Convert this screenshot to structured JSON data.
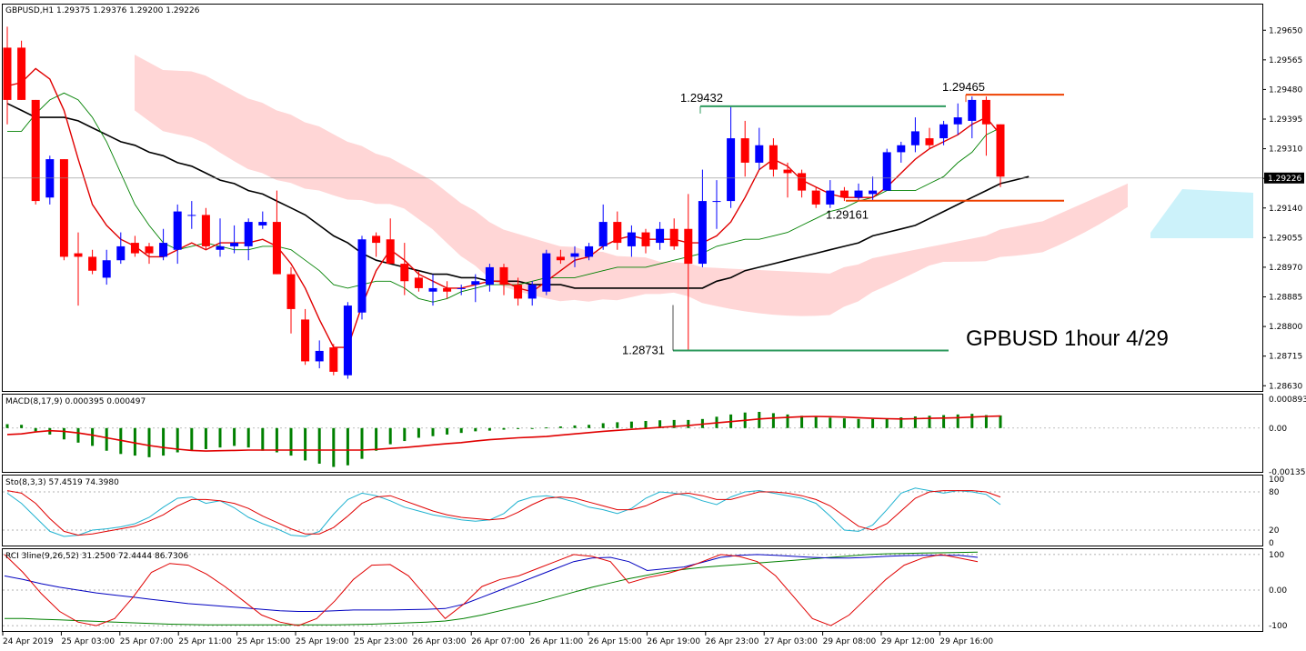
{
  "chart_data": {
    "type": "candlestick",
    "symbol_header": "GBPUSD,H1  1.29375 1.29376 1.29200 1.29226",
    "watermark": "GPBUSD 1hour 4/29",
    "price_axis": {
      "ylim": [
        1.28615,
        1.29695
      ],
      "ticks": [
        "1.29650",
        "1.29565",
        "1.29480",
        "1.29395",
        "1.29310",
        "1.29225",
        "1.29140",
        "1.29055",
        "1.28970",
        "1.28885",
        "1.28800",
        "1.28715",
        "1.28630"
      ],
      "current_price": "1.29226"
    },
    "time_labels": [
      "24 Apr 2019",
      "25 Apr 03:00",
      "25 Apr 07:00",
      "25 Apr 11:00",
      "25 Apr 15:00",
      "25 Apr 19:00",
      "25 Apr 23:00",
      "26 Apr 03:00",
      "26 Apr 07:00",
      "26 Apr 11:00",
      "26 Apr 15:00",
      "26 Apr 19:00",
      "26 Apr 23:00",
      "27 Apr 03:00",
      "29 Apr 08:00",
      "29 Apr 12:00",
      "29 Apr 16:00"
    ],
    "candles": [
      {
        "o": 1.296,
        "h": 1.2966,
        "l": 1.2938,
        "c": 1.2945
      },
      {
        "o": 1.296,
        "h": 1.2962,
        "l": 1.2945,
        "c": 1.2945
      },
      {
        "o": 1.2945,
        "h": 1.2945,
        "l": 1.2915,
        "c": 1.2916
      },
      {
        "o": 1.2917,
        "h": 1.2929,
        "l": 1.2915,
        "c": 1.2928
      },
      {
        "o": 1.2928,
        "h": 1.2928,
        "l": 1.2899,
        "c": 1.29
      },
      {
        "o": 1.2901,
        "h": 1.2907,
        "l": 1.2886,
        "c": 1.29
      },
      {
        "o": 1.29,
        "h": 1.2902,
        "l": 1.2895,
        "c": 1.2896
      },
      {
        "o": 1.2894,
        "h": 1.2902,
        "l": 1.2892,
        "c": 1.2899
      },
      {
        "o": 1.2899,
        "h": 1.2907,
        "l": 1.2898,
        "c": 1.2903
      },
      {
        "o": 1.2904,
        "h": 1.2906,
        "l": 1.29,
        "c": 1.2901
      },
      {
        "o": 1.2903,
        "h": 1.2904,
        "l": 1.2898,
        "c": 1.2901
      },
      {
        "o": 1.29,
        "h": 1.2908,
        "l": 1.2899,
        "c": 1.2904
      },
      {
        "o": 1.2902,
        "h": 1.2915,
        "l": 1.2898,
        "c": 1.2913
      },
      {
        "o": 1.2912,
        "h": 1.2916,
        "l": 1.2908,
        "c": 1.2912
      },
      {
        "o": 1.2912,
        "h": 1.2914,
        "l": 1.2902,
        "c": 1.2903
      },
      {
        "o": 1.2902,
        "h": 1.2911,
        "l": 1.29,
        "c": 1.2903
      },
      {
        "o": 1.2903,
        "h": 1.2909,
        "l": 1.2901,
        "c": 1.2904
      },
      {
        "o": 1.2903,
        "h": 1.2911,
        "l": 1.2899,
        "c": 1.291
      },
      {
        "o": 1.2909,
        "h": 1.2913,
        "l": 1.2908,
        "c": 1.291
      },
      {
        "o": 1.291,
        "h": 1.2919,
        "l": 1.2895,
        "c": 1.2895
      },
      {
        "o": 1.2895,
        "h": 1.2897,
        "l": 1.2878,
        "c": 1.2885
      },
      {
        "o": 1.2882,
        "h": 1.2885,
        "l": 1.2869,
        "c": 1.287
      },
      {
        "o": 1.287,
        "h": 1.2876,
        "l": 1.2868,
        "c": 1.2873
      },
      {
        "o": 1.2874,
        "h": 1.2875,
        "l": 1.2866,
        "c": 1.2867
      },
      {
        "o": 1.2866,
        "h": 1.2887,
        "l": 1.2865,
        "c": 1.2886
      },
      {
        "o": 1.2884,
        "h": 1.2906,
        "l": 1.2882,
        "c": 1.2905
      },
      {
        "o": 1.2906,
        "h": 1.2907,
        "l": 1.29,
        "c": 1.2904
      },
      {
        "o": 1.2905,
        "h": 1.2911,
        "l": 1.2898,
        "c": 1.2898
      },
      {
        "o": 1.2898,
        "h": 1.2904,
        "l": 1.2889,
        "c": 1.2893
      },
      {
        "o": 1.2894,
        "h": 1.2896,
        "l": 1.289,
        "c": 1.2891
      },
      {
        "o": 1.289,
        "h": 1.2895,
        "l": 1.2886,
        "c": 1.2891
      },
      {
        "o": 1.2891,
        "h": 1.2893,
        "l": 1.2888,
        "c": 1.289
      },
      {
        "o": 1.2891,
        "h": 1.2892,
        "l": 1.2889,
        "c": 1.2891
      },
      {
        "o": 1.2892,
        "h": 1.2895,
        "l": 1.2887,
        "c": 1.2893
      },
      {
        "o": 1.2892,
        "h": 1.2898,
        "l": 1.289,
        "c": 1.2897
      },
      {
        "o": 1.2897,
        "h": 1.2898,
        "l": 1.2889,
        "c": 1.2892
      },
      {
        "o": 1.2892,
        "h": 1.2894,
        "l": 1.2886,
        "c": 1.2888
      },
      {
        "o": 1.2888,
        "h": 1.2893,
        "l": 1.2886,
        "c": 1.2892
      },
      {
        "o": 1.289,
        "h": 1.2902,
        "l": 1.2889,
        "c": 1.2901
      },
      {
        "o": 1.29,
        "h": 1.2902,
        "l": 1.2898,
        "c": 1.2899
      },
      {
        "o": 1.29,
        "h": 1.2903,
        "l": 1.2897,
        "c": 1.2901
      },
      {
        "o": 1.29,
        "h": 1.2904,
        "l": 1.2899,
        "c": 1.2903
      },
      {
        "o": 1.2903,
        "h": 1.2915,
        "l": 1.2902,
        "c": 1.291
      },
      {
        "o": 1.291,
        "h": 1.2913,
        "l": 1.2902,
        "c": 1.2904
      },
      {
        "o": 1.2903,
        "h": 1.2909,
        "l": 1.29,
        "c": 1.2907
      },
      {
        "o": 1.2907,
        "h": 1.2908,
        "l": 1.2901,
        "c": 1.2903
      },
      {
        "o": 1.2904,
        "h": 1.291,
        "l": 1.2902,
        "c": 1.2908
      },
      {
        "o": 1.2908,
        "h": 1.2911,
        "l": 1.2902,
        "c": 1.2903
      },
      {
        "o": 1.2908,
        "h": 1.2918,
        "l": 1.2873,
        "c": 1.2898
      },
      {
        "o": 1.2898,
        "h": 1.2925,
        "l": 1.2897,
        "c": 1.2916
      },
      {
        "o": 1.2916,
        "h": 1.2922,
        "l": 1.2908,
        "c": 1.2916
      },
      {
        "o": 1.2916,
        "h": 1.2943,
        "l": 1.2914,
        "c": 1.2934
      },
      {
        "o": 1.2934,
        "h": 1.2939,
        "l": 1.2923,
        "c": 1.2927
      },
      {
        "o": 1.2927,
        "h": 1.2937,
        "l": 1.2925,
        "c": 1.2932
      },
      {
        "o": 1.2932,
        "h": 1.2934,
        "l": 1.2923,
        "c": 1.2925
      },
      {
        "o": 1.2925,
        "h": 1.2927,
        "l": 1.2917,
        "c": 1.2924
      },
      {
        "o": 1.2924,
        "h": 1.2925,
        "l": 1.2917,
        "c": 1.2919
      },
      {
        "o": 1.2919,
        "h": 1.292,
        "l": 1.2914,
        "c": 1.2915
      },
      {
        "o": 1.2915,
        "h": 1.2922,
        "l": 1.2914,
        "c": 1.2919
      },
      {
        "o": 1.2919,
        "h": 1.292,
        "l": 1.2916,
        "c": 1.2917
      },
      {
        "o": 1.2917,
        "h": 1.2921,
        "l": 1.2916,
        "c": 1.2919
      },
      {
        "o": 1.2918,
        "h": 1.2923,
        "l": 1.2916,
        "c": 1.2919
      },
      {
        "o": 1.2919,
        "h": 1.2931,
        "l": 1.2919,
        "c": 1.293
      },
      {
        "o": 1.293,
        "h": 1.2933,
        "l": 1.2927,
        "c": 1.2932
      },
      {
        "o": 1.2932,
        "h": 1.294,
        "l": 1.293,
        "c": 1.2936
      },
      {
        "o": 1.2934,
        "h": 1.2937,
        "l": 1.2931,
        "c": 1.2932
      },
      {
        "o": 1.2934,
        "h": 1.2939,
        "l": 1.2932,
        "c": 1.2938
      },
      {
        "o": 1.2938,
        "h": 1.2944,
        "l": 1.2935,
        "c": 1.294
      },
      {
        "o": 1.2939,
        "h": 1.2946,
        "l": 1.2934,
        "c": 1.2945
      },
      {
        "o": 1.2945,
        "h": 1.2946,
        "l": 1.2929,
        "c": 1.2938
      },
      {
        "o": 1.2938,
        "h": 1.2938,
        "l": 1.292,
        "c": 1.2923
      }
    ],
    "overlays": {
      "fast_ma": {
        "color": "#e00000",
        "values": [
          1.2949,
          1.295,
          1.2954,
          1.2951,
          1.2942,
          1.2928,
          1.2915,
          1.2909,
          1.2905,
          1.2903,
          1.29,
          1.29,
          1.2902,
          1.2904,
          1.2902,
          1.2904,
          1.2904,
          1.2904,
          1.2905,
          1.2903,
          1.2898,
          1.2891,
          1.2882,
          1.2874,
          1.2874,
          1.2886,
          1.2896,
          1.2902,
          1.2899,
          1.2895,
          1.2893,
          1.2891,
          1.2891,
          1.2892,
          1.2893,
          1.2893,
          1.2891,
          1.289,
          1.2893,
          1.2896,
          1.2899,
          1.29,
          1.2903,
          1.2905,
          1.2906,
          1.2905,
          1.2905,
          1.2905,
          1.2904,
          1.2904,
          1.2906,
          1.291,
          1.2917,
          1.2925,
          1.2928,
          1.2926,
          1.2922,
          1.292,
          1.2918,
          1.2917,
          1.2917,
          1.2917,
          1.292,
          1.2924,
          1.2928,
          1.2931,
          1.2933,
          1.2935,
          1.2938,
          1.294,
          1.2935
        ]
      },
      "mid_ma": {
        "color": "#008000",
        "values": [
          1.2936,
          1.2936,
          1.2941,
          1.2945,
          1.2947,
          1.2945,
          1.294,
          1.2933,
          1.2924,
          1.2915,
          1.2909,
          1.2904,
          1.2902,
          1.2903,
          1.2904,
          1.2903,
          1.2902,
          1.2902,
          1.2903,
          1.2903,
          1.2902,
          1.2899,
          1.2896,
          1.2892,
          1.2891,
          1.2892,
          1.2893,
          1.2893,
          1.2891,
          1.2888,
          1.2887,
          1.2888,
          1.289,
          1.2891,
          1.2892,
          1.2892,
          1.2892,
          1.2893,
          1.2894,
          1.2894,
          1.2894,
          1.2895,
          1.2896,
          1.2897,
          1.2897,
          1.2897,
          1.2898,
          1.2899,
          1.29,
          1.2901,
          1.2903,
          1.2904,
          1.2905,
          1.2905,
          1.2906,
          1.2907,
          1.2909,
          1.2911,
          1.2913,
          1.2914,
          1.2916,
          1.2917,
          1.2919,
          1.2919,
          1.2919,
          1.2921,
          1.2923,
          1.2927,
          1.293,
          1.2935,
          1.2937
        ]
      },
      "slow_ma": {
        "color": "#000000",
        "values": [
          1.2944,
          1.2942,
          1.294,
          1.294,
          1.294,
          1.2939,
          1.2937,
          1.2935,
          1.2933,
          1.2932,
          1.293,
          1.2929,
          1.2927,
          1.2926,
          1.2924,
          1.2922,
          1.2921,
          1.2919,
          1.2918,
          1.2916,
          1.2914,
          1.2912,
          1.2909,
          1.2906,
          1.2904,
          1.2901,
          1.2899,
          1.2898,
          1.2897,
          1.2896,
          1.2895,
          1.2895,
          1.2894,
          1.2894,
          1.2893,
          1.2893,
          1.2893,
          1.2892,
          1.2892,
          1.2892,
          1.2891,
          1.2891,
          1.2891,
          1.2891,
          1.2891,
          1.2891,
          1.2891,
          1.2891,
          1.2891,
          1.2891,
          1.2893,
          1.2894,
          1.2896,
          1.2897,
          1.2898,
          1.2899,
          1.29,
          1.2901,
          1.2902,
          1.2903,
          1.2904,
          1.2906,
          1.2907,
          1.2908,
          1.2909,
          1.2911,
          1.2913,
          1.2915,
          1.2917,
          1.2919,
          1.2921,
          1.2922,
          1.2923
        ]
      }
    },
    "cloud": {
      "color": "#ffd6d6",
      "future_color": "#ccf2fa"
    },
    "levels": [
      {
        "label": "1.29432",
        "price": 1.29432,
        "color": "#2e9a5e"
      },
      {
        "label": "1.29465",
        "price": 1.29465,
        "color": "#ee4000"
      },
      {
        "label": "1.29161",
        "price": 1.29161,
        "color": "#ee4000"
      },
      {
        "label": "1.28731",
        "price": 1.28731,
        "color": "#2e9a5e"
      }
    ],
    "macd": {
      "header": "MACD(8,17,9) 0.000395 0.000497",
      "ticks": [
        "0.000893",
        "0.00",
        "-0.001353"
      ],
      "ylim": [
        -0.001353,
        0.000893
      ],
      "hist": [
        0.00012,
        0.0001,
        -0.0001,
        -0.0002,
        -0.00035,
        -0.00045,
        -0.00055,
        -0.0007,
        -0.0008,
        -0.00085,
        -0.0009,
        -0.00085,
        -0.00075,
        -0.0007,
        -0.00065,
        -0.0006,
        -0.00055,
        -0.0006,
        -0.0007,
        -0.00075,
        -0.00085,
        -0.001,
        -0.0011,
        -0.0012,
        -0.00115,
        -0.00095,
        -0.0007,
        -0.0005,
        -0.0004,
        -0.0003,
        -0.00025,
        -0.0002,
        -0.00015,
        -0.0001,
        -8e-05,
        -5e-05,
        -3e-05,
        -2e-05,
        2e-05,
        5e-05,
        8e-05,
        0.0001,
        0.00015,
        0.00018,
        0.0002,
        0.00022,
        0.00024,
        0.00025,
        0.00025,
        0.00028,
        0.00035,
        0.00042,
        0.00048,
        0.0005,
        0.00046,
        0.00042,
        0.00038,
        0.00036,
        0.00032,
        0.0003,
        0.00028,
        0.00028,
        0.0003,
        0.00033,
        0.00036,
        0.00038,
        0.0004,
        0.00042,
        0.00044,
        0.0004,
        0.00039
      ],
      "signal": [
        -0.0002,
        -0.00018,
        -0.00012,
        -8e-05,
        -0.0001,
        -0.00015,
        -0.00022,
        -0.0003,
        -0.00038,
        -0.00046,
        -0.00054,
        -0.0006,
        -0.00065,
        -0.00069,
        -0.00071,
        -0.0007,
        -0.00069,
        -0.00068,
        -0.00068,
        -0.00068,
        -0.00068,
        -0.00068,
        -0.00068,
        -0.00068,
        -0.00068,
        -0.00068,
        -0.00066,
        -0.00063,
        -0.0006,
        -0.00056,
        -0.00052,
        -0.00048,
        -0.00045,
        -0.0004,
        -0.00036,
        -0.00033,
        -0.0003,
        -0.00028,
        -0.00026,
        -0.00022,
        -0.00018,
        -0.00014,
        -0.0001,
        -7e-05,
        -4e-05,
        -1e-05,
        2e-05,
        5e-05,
        8e-05,
        0.00012,
        0.00016,
        0.0002,
        0.00024,
        0.00028,
        0.00031,
        0.00033,
        0.00035,
        0.00036,
        0.00035,
        0.00034,
        0.00032,
        0.0003,
        0.00029,
        0.00028,
        0.00029,
        0.0003,
        0.00031,
        0.00032,
        0.00034,
        0.00036,
        0.00037
      ]
    },
    "stochastic": {
      "header": "Sto(8,3,3) 57.4519 74.3980",
      "ticks": [
        "100",
        "80",
        "20",
        "0"
      ],
      "ylim": [
        0,
        100
      ],
      "k": [
        78,
        62,
        40,
        18,
        10,
        12,
        20,
        22,
        25,
        30,
        40,
        56,
        70,
        72,
        62,
        66,
        55,
        40,
        30,
        22,
        12,
        10,
        18,
        45,
        68,
        78,
        74,
        66,
        56,
        50,
        44,
        40,
        36,
        34,
        36,
        46,
        65,
        72,
        74,
        70,
        64,
        56,
        52,
        46,
        54,
        70,
        80,
        78,
        74,
        66,
        60,
        72,
        80,
        82,
        78,
        74,
        70,
        62,
        42,
        20,
        18,
        28,
        52,
        78,
        86,
        82,
        78,
        82,
        80,
        76,
        60
      ],
      "d": [
        82,
        78,
        62,
        38,
        18,
        12,
        14,
        18,
        22,
        26,
        34,
        44,
        58,
        68,
        68,
        66,
        62,
        54,
        42,
        32,
        22,
        14,
        14,
        24,
        42,
        62,
        72,
        74,
        66,
        58,
        50,
        44,
        40,
        38,
        36,
        38,
        48,
        60,
        70,
        72,
        70,
        64,
        58,
        52,
        52,
        58,
        68,
        76,
        78,
        74,
        68,
        68,
        74,
        80,
        80,
        78,
        74,
        68,
        58,
        42,
        26,
        20,
        30,
        50,
        70,
        80,
        82,
        82,
        82,
        80,
        72
      ]
    },
    "rci": {
      "header": "RCI 3line(9,26,52) 31.2500 72.4444 86.7306",
      "ticks": [
        "100",
        "0.00",
        "-100"
      ],
      "ylim": [
        -110,
        110
      ],
      "short": [
        100,
        50,
        -10,
        -60,
        -90,
        -100,
        -80,
        -20,
        50,
        75,
        70,
        45,
        10,
        -30,
        -70,
        -90,
        -100,
        -80,
        -30,
        30,
        70,
        72,
        40,
        -20,
        -80,
        -40,
        10,
        30,
        40,
        60,
        80,
        100,
        95,
        80,
        20,
        35,
        45,
        60,
        80,
        100,
        95,
        80,
        40,
        -20,
        -80,
        -100,
        -70,
        -20,
        30,
        70,
        90,
        100,
        90,
        80
      ],
      "mid": [
        40,
        30,
        18,
        8,
        0,
        -8,
        -14,
        -20,
        -26,
        -32,
        -38,
        -42,
        -46,
        -50,
        -54,
        -58,
        -60,
        -60,
        -58,
        -56,
        -56,
        -56,
        -55,
        -54,
        -52,
        -40,
        -20,
        0,
        20,
        40,
        60,
        80,
        90,
        92,
        80,
        55,
        60,
        65,
        78,
        92,
        98,
        100,
        98,
        95,
        92,
        90,
        90,
        92,
        95,
        97,
        98,
        98,
        98,
        92
      ],
      "long": [
        -80,
        -80,
        -82,
        -84,
        -86,
        -88,
        -90,
        -92,
        -94,
        -96,
        -97,
        -98,
        -98,
        -98,
        -98,
        -98,
        -98,
        -98,
        -98,
        -97,
        -96,
        -94,
        -92,
        -90,
        -87,
        -80,
        -70,
        -58,
        -46,
        -34,
        -20,
        -6,
        8,
        20,
        32,
        42,
        52,
        58,
        64,
        68,
        72,
        76,
        80,
        84,
        88,
        92,
        96,
        100,
        102,
        103,
        104,
        105,
        106,
        107
      ]
    }
  }
}
